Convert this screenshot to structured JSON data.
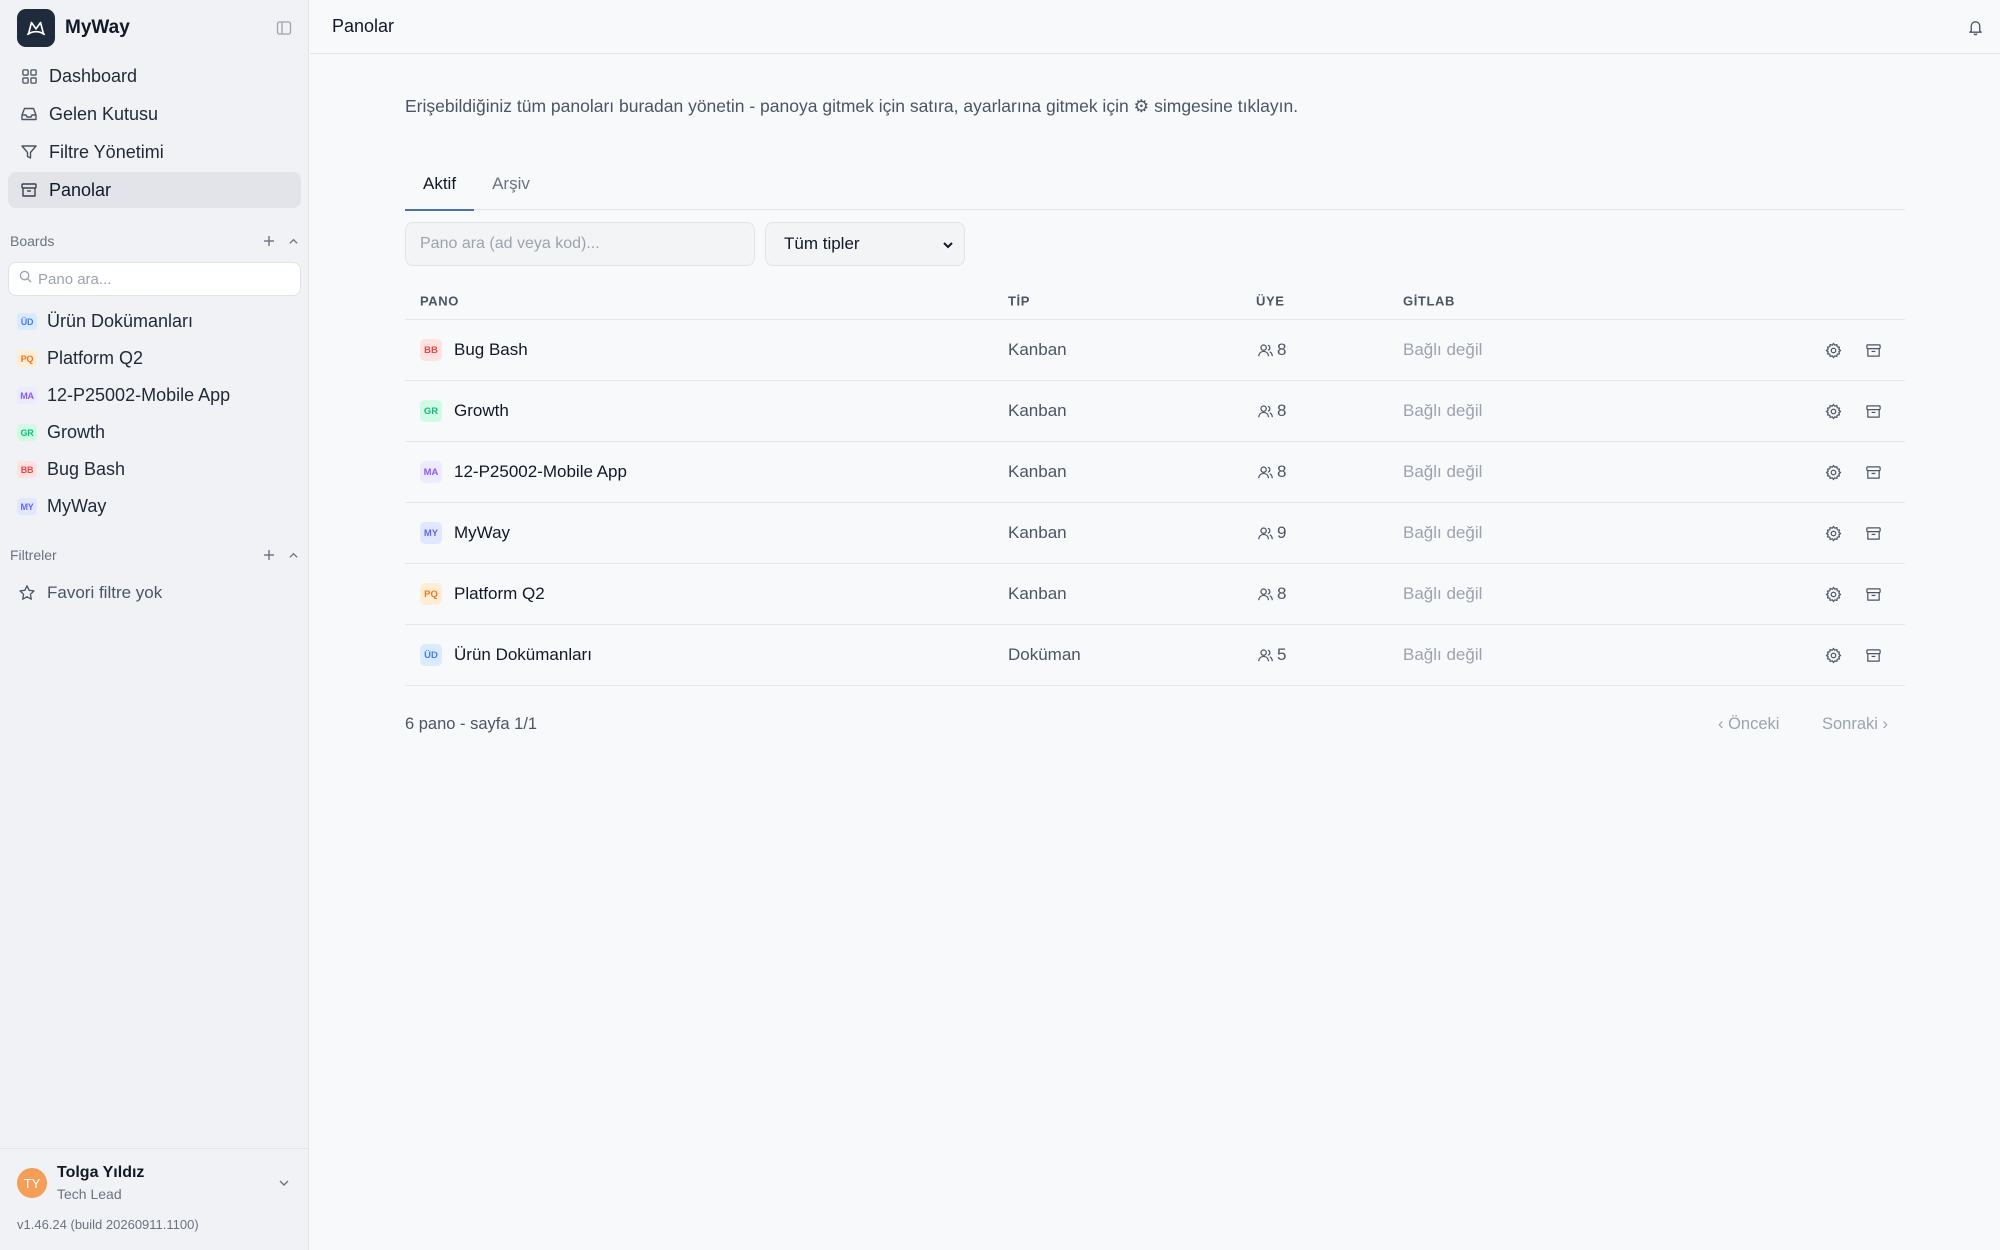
{
  "app": {
    "name": "MyWay"
  },
  "nav": [
    {
      "label": "Dashboard",
      "icon": "dashboard-icon"
    },
    {
      "label": "Gelen Kutusu",
      "icon": "inbox-icon"
    },
    {
      "label": "Filtre Yönetimi",
      "icon": "filter-icon"
    },
    {
      "label": "Panolar",
      "icon": "archive-box-icon",
      "active": true
    }
  ],
  "boards_section": {
    "title": "Boards",
    "search_placeholder": "Pano ara...",
    "items": [
      {
        "badge": "ÜD",
        "label": "Ürün Dokümanları",
        "bg": "#dbeafe",
        "fg": "#3b82f6"
      },
      {
        "badge": "PQ",
        "label": "Platform Q2",
        "bg": "#ffedd5",
        "fg": "#f97316"
      },
      {
        "badge": "MA",
        "label": "12-P25002-Mobile App",
        "bg": "#ede9fe",
        "fg": "#8b5cf6"
      },
      {
        "badge": "GR",
        "label": "Growth",
        "bg": "#d1fae5",
        "fg": "#10b981"
      },
      {
        "badge": "BB",
        "label": "Bug Bash",
        "bg": "#fee2e2",
        "fg": "#ef4444"
      },
      {
        "badge": "MY",
        "label": "MyWay",
        "bg": "#e0e7ff",
        "fg": "#6366f1"
      }
    ]
  },
  "filters_section": {
    "title": "Filtreler",
    "empty": "Favori filtre yok"
  },
  "user": {
    "initials": "TY",
    "name": "Tolga Yıldız",
    "role": "Tech Lead",
    "version": "v1.46.24 (build 20260911.1100)"
  },
  "header": {
    "title": "Panolar"
  },
  "main": {
    "description": "Erişebildiğiniz tüm panoları buradan yönetin - panoya gitmek için satıra, ayarlarına gitmek için ⚙ simgesine tıklayın.",
    "tabs": [
      {
        "label": "Aktif",
        "active": true
      },
      {
        "label": "Arşiv"
      }
    ],
    "search_placeholder": "Pano ara (ad veya kod)...",
    "type_filter": "Tüm tipler",
    "columns": {
      "pano": "PANO",
      "tip": "TİP",
      "uye": "ÜYE",
      "gitlab": "GİTLAB"
    },
    "rows": [
      {
        "badge": "BB",
        "name": "Bug Bash",
        "type": "Kanban",
        "members": "8",
        "gitlab": "Bağlı değil",
        "bg": "#fee2e2",
        "fg": "#ef4444"
      },
      {
        "badge": "GR",
        "name": "Growth",
        "type": "Kanban",
        "members": "8",
        "gitlab": "Bağlı değil",
        "bg": "#d1fae5",
        "fg": "#10b981"
      },
      {
        "badge": "MA",
        "name": "12-P25002-Mobile App",
        "type": "Kanban",
        "members": "8",
        "gitlab": "Bağlı değil",
        "bg": "#ede9fe",
        "fg": "#8b5cf6"
      },
      {
        "badge": "MY",
        "name": "MyWay",
        "type": "Kanban",
        "members": "9",
        "gitlab": "Bağlı değil",
        "bg": "#e0e7ff",
        "fg": "#6366f1"
      },
      {
        "badge": "PQ",
        "name": "Platform Q2",
        "type": "Kanban",
        "members": "8",
        "gitlab": "Bağlı değil",
        "bg": "#ffedd5",
        "fg": "#f97316"
      },
      {
        "badge": "ÜD",
        "name": "Ürün Dokümanları",
        "type": "Doküman",
        "members": "5",
        "gitlab": "Bağlı değil",
        "bg": "#dbeafe",
        "fg": "#3b82f6"
      }
    ],
    "pagination": {
      "summary": "6 pano - sayfa 1/1",
      "prev": "‹ Önceki",
      "next": "Sonraki ›"
    }
  }
}
